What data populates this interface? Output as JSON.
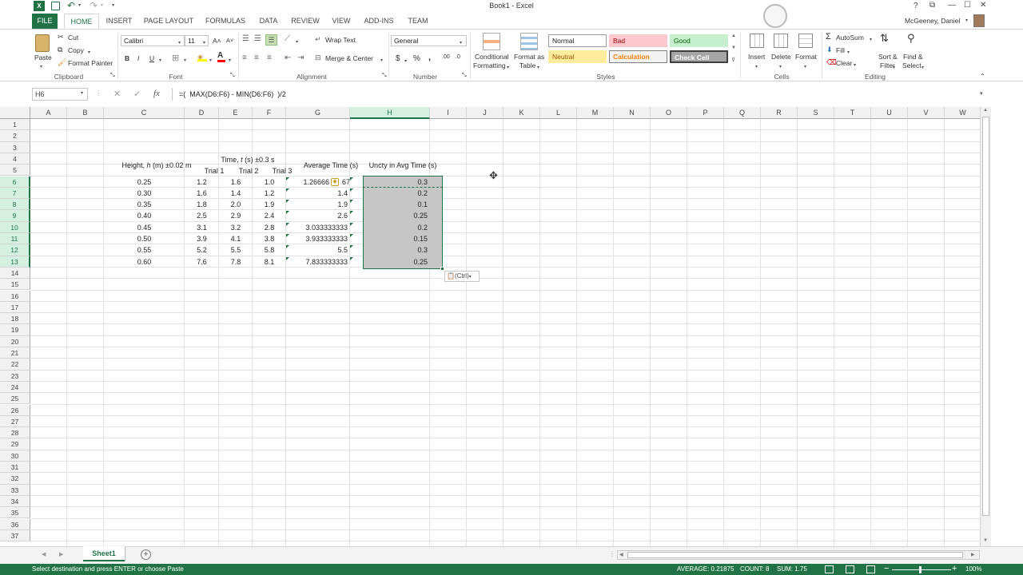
{
  "title_bar": {
    "doc_title": "Book1 - Excel",
    "user": "McGeeney, Daniel",
    "help": "?",
    "min": "—",
    "max": "☐",
    "close": "✕",
    "ribbon_opts": "⧉"
  },
  "tabs": [
    "FILE",
    "HOME",
    "INSERT",
    "PAGE LAYOUT",
    "FORMULAS",
    "DATA",
    "REVIEW",
    "VIEW",
    "ADD-INS",
    "TEAM"
  ],
  "clipboard": {
    "paste": "Paste",
    "cut": "Cut",
    "copy": "Copy",
    "format_painter": "Format Painter",
    "label": "Clipboard"
  },
  "font": {
    "name": "Calibri",
    "size": "11",
    "label": "Font",
    "grow": "A˄",
    "shrink": "A˅",
    "bold": "B",
    "italic": "I",
    "underline": "U"
  },
  "alignment": {
    "wrap": "Wrap Text",
    "merge": "Merge & Center",
    "label": "Alignment"
  },
  "number": {
    "format": "General",
    "label": "Number",
    "currency": "$",
    "percent": "%",
    "comma": ",",
    "inc": ".00",
    "dec": ".0"
  },
  "styles": {
    "cond": "Conditional",
    "cond2": "Formatting",
    "table": "Format as",
    "table2": "Table",
    "normal": "Normal",
    "bad": "Bad",
    "good": "Good",
    "neutral": "Neutral",
    "calculation": "Calculation",
    "check": "Check Cell",
    "label": "Styles"
  },
  "cells": {
    "insert": "Insert",
    "delete": "Delete",
    "format": "Format",
    "label": "Cells"
  },
  "editing": {
    "autosum": "AutoSum",
    "fill": "Fill",
    "clear": "Clear",
    "sort": "Sort &",
    "sort2": "Filter",
    "find": "Find &",
    "find2": "Select",
    "label": "Editing"
  },
  "formula_bar": {
    "name_box": "H6",
    "formula": "=(  MAX(D6:F6) - MIN(D6:F6)  )/2",
    "cancel": "✕",
    "enter": "✓",
    "fx": "fx"
  },
  "columns": [
    "A",
    "B",
    "C",
    "D",
    "E",
    "F",
    "G",
    "H",
    "I",
    "J",
    "K",
    "L",
    "M",
    "N",
    "O",
    "P",
    "Q",
    "R",
    "S",
    "T",
    "U",
    "V",
    "W"
  ],
  "rows": [
    "1",
    "2",
    "3",
    "4",
    "5",
    "6",
    "7",
    "8",
    "9",
    "10",
    "11",
    "12",
    "13",
    "14",
    "15",
    "16",
    "17",
    "18",
    "19",
    "20",
    "21",
    "22",
    "23",
    "24",
    "25",
    "26",
    "27",
    "28",
    "29",
    "30",
    "31",
    "32",
    "33",
    "34",
    "35",
    "36",
    "37"
  ],
  "sheet": {
    "header_height_a": "Height, ",
    "header_height_h": "h",
    "header_height_b": " (m) ±0.02 m",
    "header_time_a": "Time, ",
    "header_time_t": "t",
    "header_time_b": " (s) ±0.3 s",
    "header_avg": "Average Time (s)",
    "header_uncty": "Uncty in Avg Time (s)",
    "trial1": "Trial 1",
    "trial2": "Trial 2",
    "trial3": "Trial 3",
    "data_rows": [
      {
        "h": "0.25",
        "t1": "1.2",
        "t2": "1.6",
        "t3": "1.0",
        "avg": "1.26666",
        "u": "0.3"
      },
      {
        "h": "0.30",
        "t1": "1.6",
        "t2": "1.4",
        "t3": "1.2",
        "avg": "1.4",
        "u": "0.2"
      },
      {
        "h": "0.35",
        "t1": "1.8",
        "t2": "2.0",
        "t3": "1.9",
        "avg": "1.9",
        "u": "0.1"
      },
      {
        "h": "0.40",
        "t1": "2.5",
        "t2": "2.9",
        "t3": "2.4",
        "avg": "2.6",
        "u": "0.25"
      },
      {
        "h": "0.45",
        "t1": "3.1",
        "t2": "3.2",
        "t3": "2.8",
        "avg": "3.033333333",
        "u": "0.2"
      },
      {
        "h": "0.50",
        "t1": "3.9",
        "t2": "4.1",
        "t3": "3.8",
        "avg": "3.933333333",
        "u": "0.15"
      },
      {
        "h": "0.55",
        "t1": "5.2",
        "t2": "5.5",
        "t3": "5.8",
        "avg": "5.5",
        "u": "0.3"
      },
      {
        "h": "0.60",
        "t1": "7.6",
        "t2": "7.8",
        "t3": "8.1",
        "avg": "7.833333333",
        "u": "0.25"
      }
    ],
    "avg_row6_tail": "67",
    "paste_options": "(Ctrl)"
  },
  "sheet_tab": "Sheet1",
  "status": {
    "message": "Select destination and press ENTER or choose Paste",
    "average": "AVERAGE: 0.21875",
    "count": "COUNT: 8",
    "sum": "SUM: 1.75",
    "zoom": "100%"
  },
  "colors": {
    "accent": "#217346",
    "selection": "#c6c6c6"
  }
}
